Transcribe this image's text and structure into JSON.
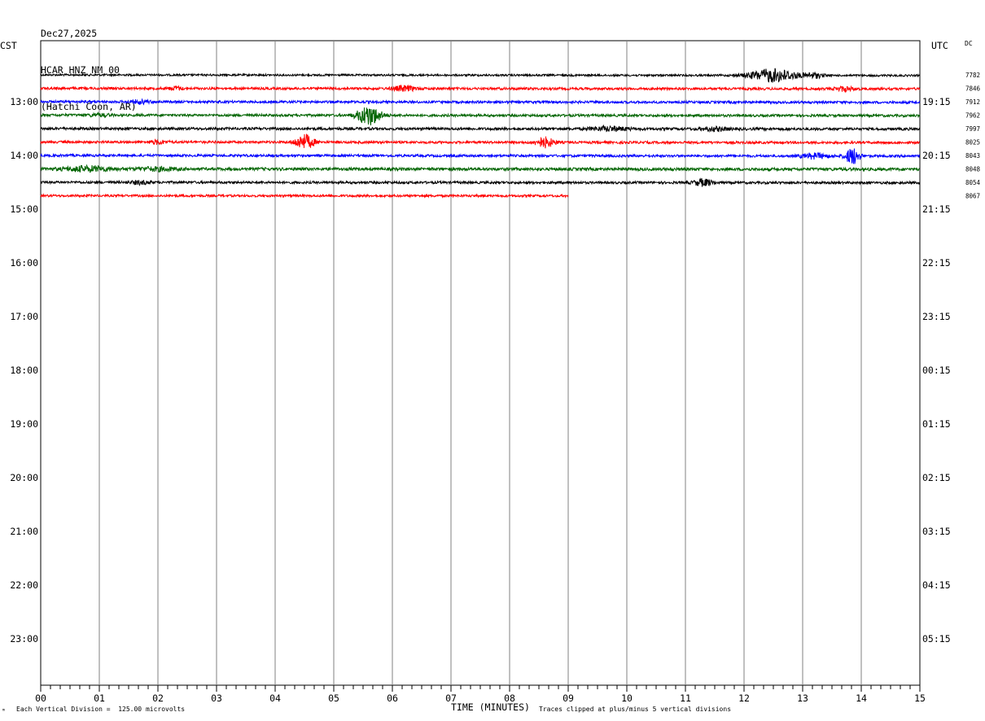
{
  "header": {
    "date": "Dec27,2025",
    "station": "HCAR HNZ NM 00",
    "location": "(Hatchi Coon, AR)"
  },
  "left_zone": "CST",
  "right_zone": "UTC",
  "dc_label": "DC",
  "footer": {
    "marker": "ᵐ",
    "scale_text": "Each Vertical Division =  125.00 microvolts",
    "xlabel": "TIME (MINUTES)",
    "clip_note": "Traces clipped at plus/minus 5 vertical divisions"
  },
  "chart_data": {
    "type": "line",
    "title": "HCAR HNZ NM 00",
    "xlabel": "TIME (MINUTES)",
    "xlim": [
      0,
      15
    ],
    "x_ticks": [
      "00",
      "01",
      "02",
      "03",
      "04",
      "05",
      "06",
      "07",
      "08",
      "09",
      "10",
      "11",
      "12",
      "13",
      "14",
      "15"
    ],
    "hour_ticks_cst": [
      "13:00",
      "14:00",
      "15:00",
      "16:00",
      "17:00",
      "18:00",
      "19:00",
      "20:00",
      "21:00",
      "22:00",
      "23:00"
    ],
    "hour_ticks_utc": [
      "19:15",
      "20:15",
      "21:15",
      "22:15",
      "23:15",
      "00:15",
      "01:15",
      "02:15",
      "03:15",
      "04:15",
      "05:15"
    ],
    "rows_per_hour": 4,
    "first_row_quarter": 2,
    "grid": true,
    "traces": [
      {
        "row": 0,
        "color": "#000000",
        "dc": "7782",
        "end_min": 15,
        "amplitude": 1.2,
        "drift": 0.4,
        "events": [
          {
            "t": 12.5,
            "amp": 8,
            "dur": 1.0
          },
          {
            "t": 13.2,
            "amp": 3,
            "dur": 0.4
          }
        ]
      },
      {
        "row": 1,
        "color": "#ff0000",
        "dc": "7846",
        "end_min": 15,
        "amplitude": 1.5,
        "drift": 0.4,
        "events": [
          {
            "t": 6.2,
            "amp": 3,
            "dur": 0.5
          },
          {
            "t": 2.3,
            "amp": 2,
            "dur": 0.3
          },
          {
            "t": 13.7,
            "amp": 2.5,
            "dur": 0.4
          }
        ]
      },
      {
        "row": 2,
        "color": "#0000ff",
        "dc": "7912",
        "end_min": 15,
        "amplitude": 1.5,
        "drift": 0.4,
        "events": [
          {
            "t": 1.7,
            "amp": 2,
            "dur": 0.4
          }
        ]
      },
      {
        "row": 3,
        "color": "#006400",
        "dc": "7962",
        "end_min": 15,
        "amplitude": 1.5,
        "drift": 0.3,
        "events": [
          {
            "t": 5.6,
            "amp": 12,
            "dur": 0.5
          },
          {
            "t": 1.0,
            "amp": 1.5,
            "dur": 0.5
          }
        ]
      },
      {
        "row": 4,
        "color": "#000000",
        "dc": "7997",
        "end_min": 15,
        "amplitude": 1.6,
        "drift": 0.3,
        "events": [
          {
            "t": 9.7,
            "amp": 2.5,
            "dur": 0.8
          },
          {
            "t": 11.5,
            "amp": 2,
            "dur": 0.6
          }
        ]
      },
      {
        "row": 5,
        "color": "#ff0000",
        "dc": "8025",
        "end_min": 15,
        "amplitude": 1.5,
        "drift": 0.4,
        "events": [
          {
            "t": 4.5,
            "amp": 9,
            "dur": 0.4
          },
          {
            "t": 8.6,
            "amp": 6,
            "dur": 0.4
          },
          {
            "t": 2.0,
            "amp": 2,
            "dur": 0.4
          }
        ]
      },
      {
        "row": 6,
        "color": "#0000ff",
        "dc": "8043",
        "end_min": 15,
        "amplitude": 1.5,
        "drift": 0.4,
        "events": [
          {
            "t": 13.85,
            "amp": 10,
            "dur": 0.3
          },
          {
            "t": 13.2,
            "amp": 3,
            "dur": 0.6
          }
        ]
      },
      {
        "row": 7,
        "color": "#006400",
        "dc": "8048",
        "end_min": 15,
        "amplitude": 1.8,
        "drift": 0.3,
        "events": [
          {
            "t": 0.8,
            "amp": 3,
            "dur": 1.0
          },
          {
            "t": 2.0,
            "amp": 2,
            "dur": 0.8
          }
        ]
      },
      {
        "row": 8,
        "color": "#000000",
        "dc": "8054",
        "end_min": 15,
        "amplitude": 1.5,
        "drift": 0.3,
        "events": [
          {
            "t": 11.3,
            "amp": 4,
            "dur": 0.4
          },
          {
            "t": 1.7,
            "amp": 2,
            "dur": 0.4
          }
        ]
      },
      {
        "row": 9,
        "color": "#ff0000",
        "dc": "8067",
        "end_min": 9,
        "amplitude": 1.4,
        "drift": 0.2,
        "events": []
      }
    ]
  }
}
